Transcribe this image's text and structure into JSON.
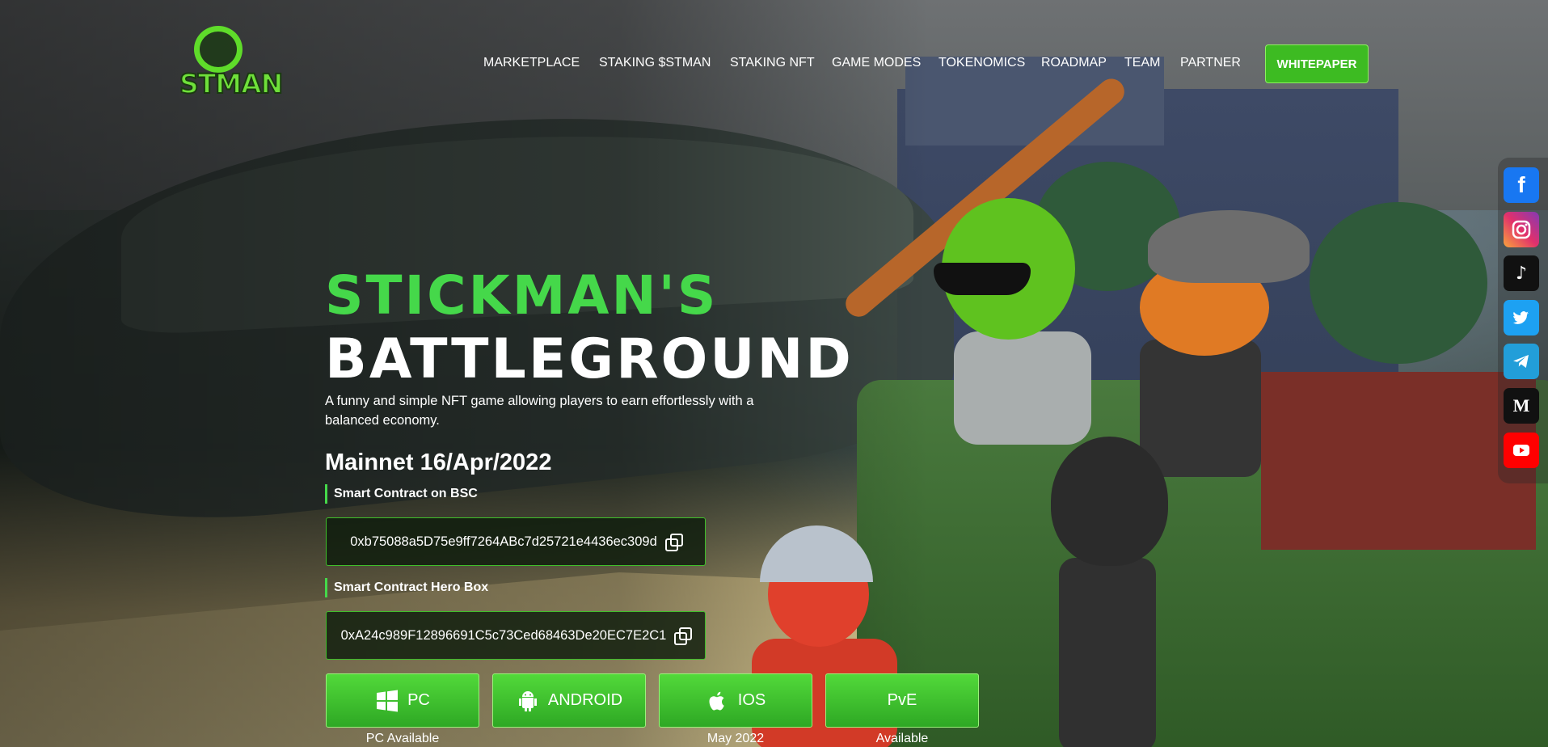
{
  "brand": {
    "logo_text": "STMAN"
  },
  "nav": {
    "items": [
      "MARKETPLACE",
      "STAKING $STMAN",
      "STAKING NFT",
      "GAME MODES",
      "TOKENOMICS",
      "ROADMAP",
      "TEAM",
      "PARTNER"
    ],
    "whitepaper": "WHITEPAPER"
  },
  "social": {
    "items": [
      {
        "name": "facebook",
        "glyph": "f",
        "color": "#1877f2"
      },
      {
        "name": "instagram",
        "glyph": "",
        "color": "#d6249f"
      },
      {
        "name": "tiktok",
        "glyph": "♪",
        "color": "#111111"
      },
      {
        "name": "twitter",
        "glyph": "",
        "color": "#1da1f2"
      },
      {
        "name": "telegram",
        "glyph": "",
        "color": "#229ed9"
      },
      {
        "name": "medium",
        "glyph": "M",
        "color": "#111111"
      },
      {
        "name": "youtube",
        "glyph": "",
        "color": "#ff0000"
      }
    ]
  },
  "hero": {
    "title_line1": "STICKMAN'S",
    "title_line2": "BATTLEGROUND",
    "description": "A funny and simple NFT game allowing players to earn effortlessly with a balanced economy.",
    "mainnet": "Mainnet 16/Apr/2022",
    "contract_bsc_label": "Smart Contract on BSC",
    "contract_bsc_address": "0xb75088a5D75e9ff7264ABc7d25721e4436ec309d",
    "contract_hero_label": "Smart Contract Hero Box",
    "contract_hero_address": "0xA24c989F12896691C5c73Ced68463De20EC7E2C1"
  },
  "platforms": [
    {
      "label": "PC",
      "icon": "windows-icon",
      "status": "PC Available"
    },
    {
      "label": "ANDROID",
      "icon": "android-icon",
      "status": ""
    },
    {
      "label": "IOS",
      "icon": "apple-icon",
      "status": "May 2022"
    },
    {
      "label": "PvE",
      "icon": "",
      "status": "Available"
    }
  ],
  "colors": {
    "accent": "#45d84a",
    "button_green": "#3dbb22"
  }
}
